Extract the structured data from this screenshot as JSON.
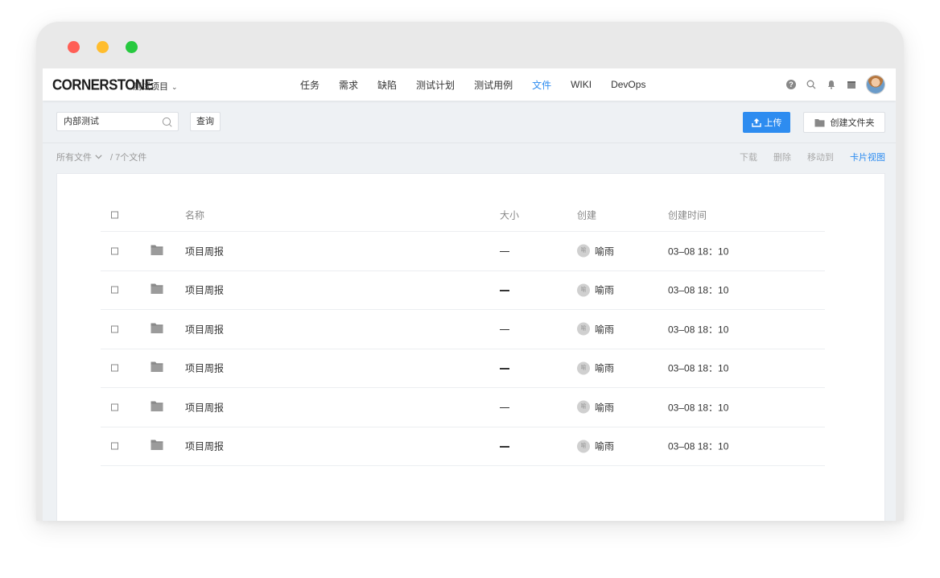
{
  "topbar": {
    "logo": "CORNERSTONE",
    "project": "测试项目",
    "nav": [
      "任务",
      "需求",
      "缺陷",
      "测试计划",
      "测试用例",
      "文件",
      "WIKI",
      "DevOps"
    ],
    "active_nav": "文件"
  },
  "toolbar": {
    "search_value": "内部测试",
    "query_label": "查询",
    "upload_label": "上传",
    "new_folder_label": "创建文件夹"
  },
  "breadcrumb": {
    "all_files": "所有文件",
    "count": "/ 7个文件"
  },
  "actions": {
    "download": "下载",
    "delete": "删除",
    "move_to": "移动到",
    "card_view": "卡片视图"
  },
  "table": {
    "headers": {
      "name": "名称",
      "size": "大小",
      "creator": "创建",
      "time": "创建时间"
    },
    "rows": [
      {
        "name": "项目周报",
        "creator": "喻雨",
        "avatar_text": "喻",
        "time": "03–08 18：10"
      },
      {
        "name": "项目周报",
        "creator": "喻雨",
        "avatar_text": "喻",
        "time": "03–08 18：10"
      },
      {
        "name": "项目周报",
        "creator": "喻雨",
        "avatar_text": "喻",
        "time": "03–08 18：10"
      },
      {
        "name": "项目周报",
        "creator": "喻雨",
        "avatar_text": "喻",
        "time": "03–08 18：10"
      },
      {
        "name": "项目周报",
        "creator": "喻雨",
        "avatar_text": "喻",
        "time": "03–08 18：10"
      },
      {
        "name": "项目周报",
        "creator": "喻雨",
        "avatar_text": "喻",
        "time": "03–08 18：10"
      }
    ]
  },
  "colors": {
    "accent": "#2d8cf0",
    "window_red": "#ff5f56",
    "window_yellow": "#ffbd2e",
    "window_green": "#27c93f"
  }
}
